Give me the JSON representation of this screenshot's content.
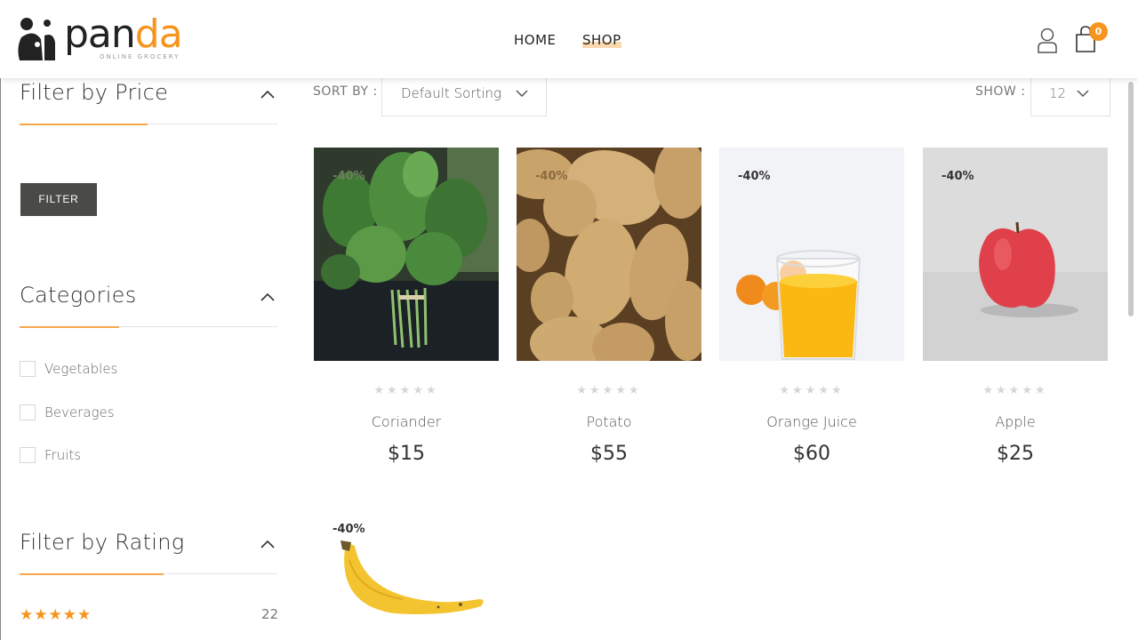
{
  "header": {
    "logo_main": "pan",
    "logo_accent": "da",
    "logo_tagline": "ONLINE GROCERY",
    "nav": [
      "HOME",
      "SHOP"
    ],
    "cart_count": "0",
    "colors": {
      "accent": "#f7941d"
    }
  },
  "sidebar": {
    "price_title": "Filter by Price",
    "filter_button": "FILTER",
    "categories_title": "Categories",
    "categories": [
      "Vegetables",
      "Beverages",
      "Fruits"
    ],
    "rating_title": "Filter by Rating",
    "rating_count": "22",
    "rating_stars": "★★★★★"
  },
  "toolbar": {
    "sort_label": "SORT BY :",
    "sort_value": "Default Sorting",
    "show_label": "SHOW :",
    "show_value": "12"
  },
  "products": [
    {
      "name": "Coriander",
      "price": "$15",
      "discount": "-40%",
      "rating": 0,
      "image": "coriander-image"
    },
    {
      "name": "Potato",
      "price": "$55",
      "discount": "-40%",
      "rating": 0,
      "image": "potato-image"
    },
    {
      "name": "Orange Juice",
      "price": "$60",
      "discount": "-40%",
      "rating": 0,
      "image": "orange-juice-image"
    },
    {
      "name": "Apple",
      "price": "$25",
      "discount": "-40%",
      "rating": 0,
      "image": "apple-image"
    },
    {
      "name": "",
      "price": "",
      "discount": "-40%",
      "rating": 0,
      "image": "banana-image"
    }
  ],
  "empty_stars": "★★★★★"
}
